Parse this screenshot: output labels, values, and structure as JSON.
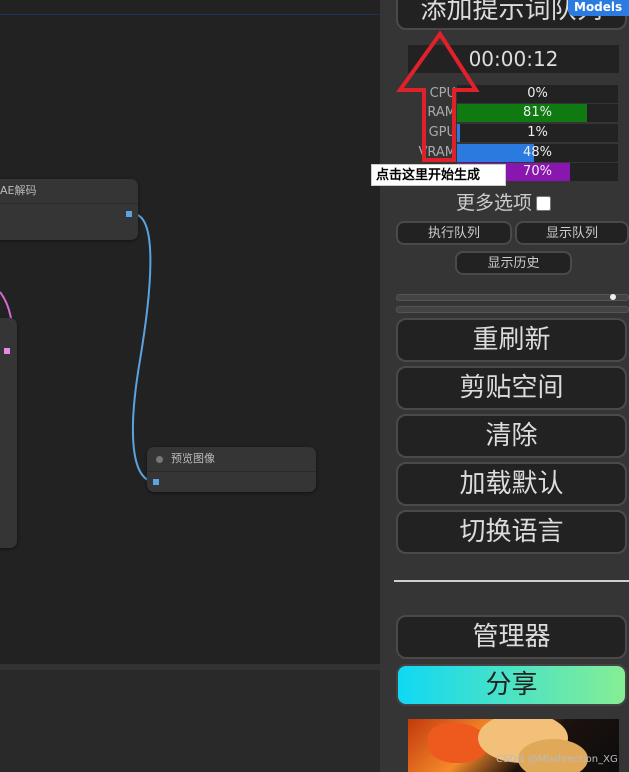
{
  "canvas": {
    "nodes": [
      {
        "title": "AE解码"
      },
      {
        "title": "预览图像"
      }
    ]
  },
  "panel": {
    "top_button": "添加提示词队列",
    "model_tag": "Models",
    "timer": "00:00:12",
    "stats": [
      {
        "label": "CPU",
        "value": "0%",
        "fraction": 0.0,
        "color": "#1a1a1a"
      },
      {
        "label": "RAM",
        "value": "81%",
        "fraction": 0.81,
        "color": "#0f7a12"
      },
      {
        "label": "GPU",
        "value": "1%",
        "fraction": 0.01,
        "color": "#2a7ae0"
      },
      {
        "label": "VRAM",
        "value": "48%",
        "fraction": 0.48,
        "color": "#2a7ae0"
      },
      {
        "label": "",
        "value": "70%",
        "fraction": 0.7,
        "color": "#8a16b0"
      }
    ],
    "more_options": "更多选项",
    "queue_button": "执行队列",
    "show_queue_button": "显示队列",
    "history_button": "显示历史",
    "refresh_button": "重刷新",
    "clipspace_button": "剪贴空间",
    "clear_button": "清除",
    "load_default_button": "加载默认",
    "switch_language_button": "切换语言",
    "manager_button": "管理器",
    "share_button": "分享"
  },
  "annotation": {
    "tooltip": "点击这里开始生成",
    "arrow_color": "#e0212b"
  },
  "watermark": "CSDN @Misdirection_XG"
}
